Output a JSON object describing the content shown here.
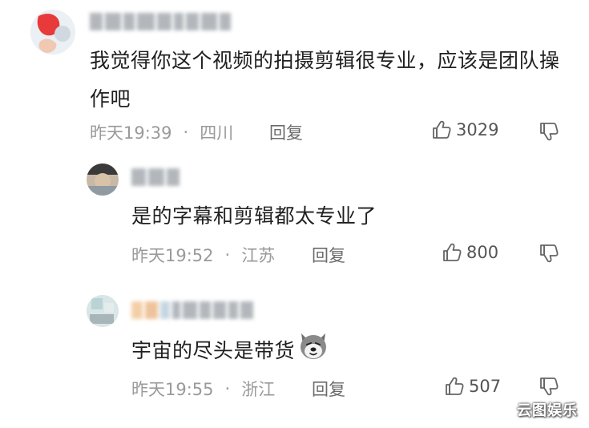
{
  "comments": [
    {
      "text": "我觉得你这个视频的拍摄剪辑很专业，应该是团队操作吧",
      "time": "昨天19:39",
      "separator": "·",
      "location": "四川",
      "reply_label": "回复",
      "likes": "3029"
    },
    {
      "text": "是的字幕和剪辑都太专业了",
      "time": "昨天19:52",
      "separator": "·",
      "location": "江苏",
      "reply_label": "回复",
      "likes": "800"
    },
    {
      "text": "宇宙的尽头是带货",
      "time": "昨天19:55",
      "separator": "·",
      "location": "浙江",
      "reply_label": "回复",
      "likes": "507"
    }
  ],
  "watermark": "云图娱乐",
  "icons": {
    "like": "thumbs-up-icon",
    "dislike": "thumbs-down-icon",
    "emoji": "dog-face-emoji"
  },
  "colors": {
    "text": "#1f1f1f",
    "meta": "#9a9a9a",
    "reply": "#6b6b6b"
  }
}
